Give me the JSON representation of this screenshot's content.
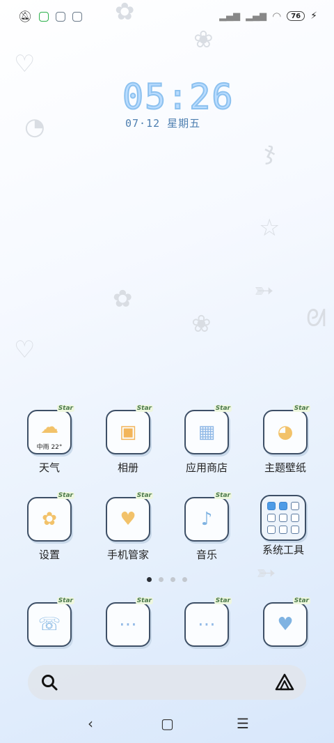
{
  "status_bar": {
    "battery_level": "76"
  },
  "clock": {
    "time": "05:26",
    "date": "07·12  星期五"
  },
  "apps_row1": [
    {
      "label": "天气",
      "icon": "weather-icon",
      "tag": "Star",
      "sub": "中雨 22°"
    },
    {
      "label": "相册",
      "icon": "gallery-icon",
      "tag": "Star"
    },
    {
      "label": "应用商店",
      "icon": "app-store-icon",
      "tag": "Star"
    },
    {
      "label": "主题壁纸",
      "icon": "theme-palette-icon",
      "tag": "Star"
    }
  ],
  "apps_row2": [
    {
      "label": "设置",
      "icon": "settings-icon",
      "tag": "Star"
    },
    {
      "label": "手机管家",
      "icon": "phone-manager-icon",
      "tag": "Star"
    },
    {
      "label": "音乐",
      "icon": "music-icon",
      "tag": "Star"
    },
    {
      "label": "系统工具",
      "icon": "system-tools-folder-icon"
    }
  ],
  "dock": [
    {
      "icon": "phone-icon",
      "tag": "Star"
    },
    {
      "icon": "messages-icon",
      "tag": "Star"
    },
    {
      "icon": "chat-icon",
      "tag": "Star"
    },
    {
      "icon": "browser-icon",
      "tag": "Star"
    }
  ],
  "page_indicator": {
    "pages": 4,
    "active": 1
  },
  "search": {
    "icon": "search-icon",
    "assistant": "assistant-icon"
  },
  "nav": {
    "back": "‹",
    "home": "▢",
    "menu": "☰"
  }
}
